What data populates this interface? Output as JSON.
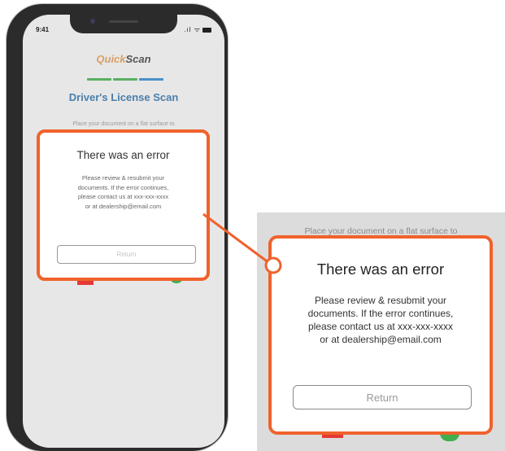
{
  "status_bar": {
    "time": "9:41",
    "signal": ".ıl ᯤ"
  },
  "app": {
    "brand_first": "Quick",
    "brand_second": "Scan",
    "title": "Driver's License Scan"
  },
  "instruction_phone": "Place your document on a flat surface to",
  "instruction_zoom": "Place your document on a flat surface to",
  "modal": {
    "title": "There was an error",
    "body_lines": [
      "Please review & resubmit your",
      "documents. If the error continues,",
      "please contact us at xxx-xxx-xxxx",
      "or at dealership@email.com"
    ],
    "button_label": "Return"
  },
  "colors": {
    "accent": "#f0622c",
    "step_done": "#58b062",
    "step_current": "#4a8fc8",
    "title": "#4a7fab"
  }
}
